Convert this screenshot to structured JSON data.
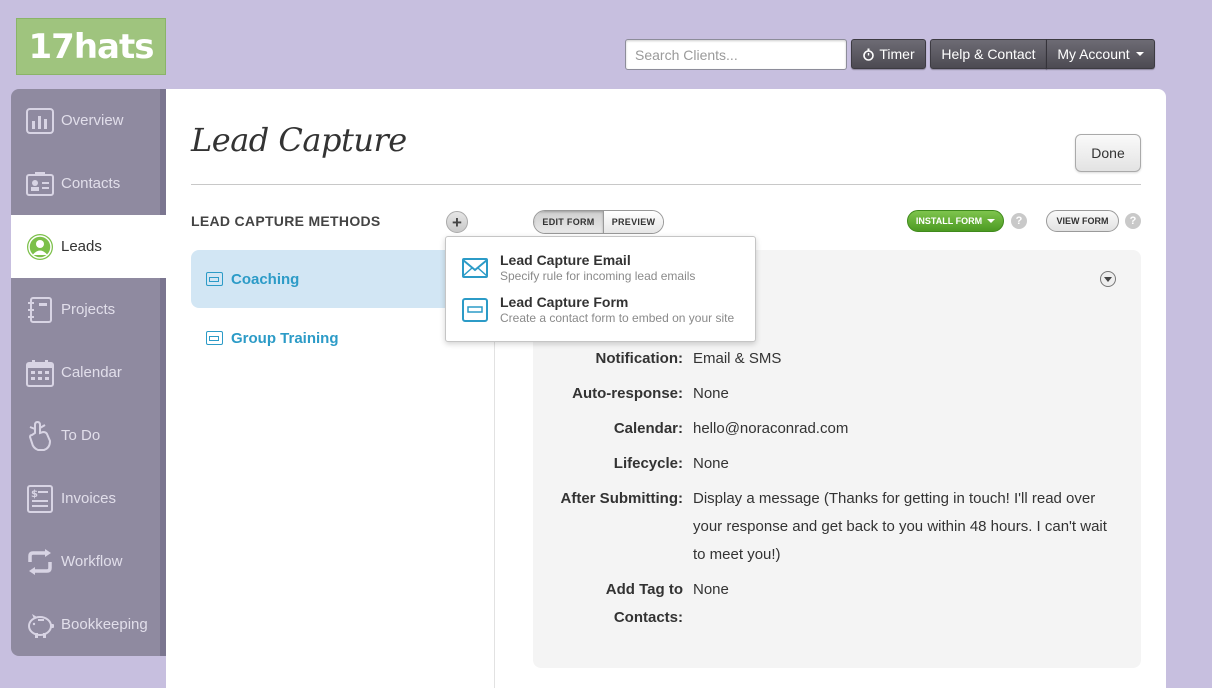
{
  "logo": {
    "text": "17hats"
  },
  "topbar": {
    "search_placeholder": "Search Clients...",
    "timer_label": "Timer",
    "help_label": "Help & Contact",
    "account_label": "My Account"
  },
  "sidebar": {
    "items": [
      {
        "label": "Overview",
        "icon": "bar-chart-icon"
      },
      {
        "label": "Contacts",
        "icon": "contact-card-icon"
      },
      {
        "label": "Leads",
        "icon": "person-circle-icon"
      },
      {
        "label": "Projects",
        "icon": "notebook-icon"
      },
      {
        "label": "Calendar",
        "icon": "calendar-icon"
      },
      {
        "label": "To Do",
        "icon": "ribbon-finger-icon"
      },
      {
        "label": "Invoices",
        "icon": "invoice-icon"
      },
      {
        "label": "Workflow",
        "icon": "cycle-arrows-icon"
      },
      {
        "label": "Bookkeeping",
        "icon": "piggy-bank-icon"
      }
    ],
    "active": "Leads"
  },
  "main": {
    "title": "Lead Capture",
    "done_label": "Done",
    "methods_heading": "LEAD CAPTURE METHODS",
    "methods": [
      {
        "label": "Coaching",
        "selected": true
      },
      {
        "label": "Group Training",
        "selected": false
      }
    ],
    "toolbar": {
      "edit_form": "EDIT FORM",
      "preview": "PREVIEW",
      "install_form": "INSTALL FORM",
      "view_form": "VIEW FORM",
      "help": "?"
    },
    "details": [
      {
        "label": "Notification:",
        "value": "Email & SMS"
      },
      {
        "label": "Auto-response:",
        "value": "None"
      },
      {
        "label": "Calendar:",
        "value": "hello@noraconrad.com"
      },
      {
        "label": "Lifecycle:",
        "value": "None"
      },
      {
        "label": "After Submitting:",
        "value": "Display a message (Thanks for getting in touch! I'll read over your response and get back to you within 48 hours. I can't wait to meet you!)"
      },
      {
        "label": "Add Tag to Contacts:",
        "value": "None"
      }
    ]
  },
  "dropdown": {
    "items": [
      {
        "title": "Lead Capture Email",
        "subtitle": "Specify rule for incoming lead emails",
        "icon": "envelope-icon"
      },
      {
        "title": "Lead Capture Form",
        "subtitle": "Create a contact form to embed on your site",
        "icon": "form-icon"
      }
    ]
  },
  "colors": {
    "background": "#c7bfdf",
    "sidebar": "#8f8aa0",
    "accent_blue": "#2c9bc7",
    "install_green": "#5aa62e",
    "logo_green": "#9fc47e"
  }
}
